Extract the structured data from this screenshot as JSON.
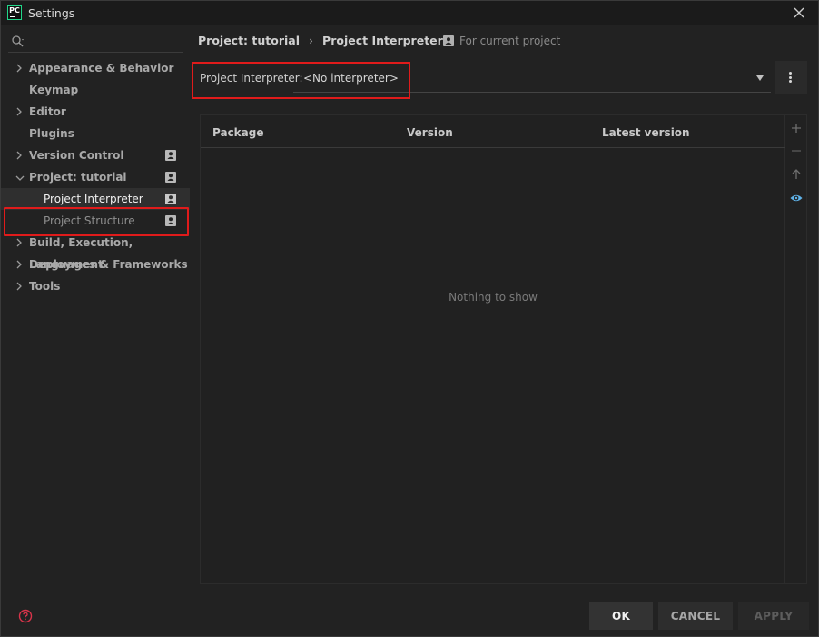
{
  "window": {
    "title": "Settings",
    "logo_text": "PC"
  },
  "search": {
    "placeholder": ""
  },
  "sidebar": {
    "items": [
      {
        "label": "Appearance & Behavior",
        "expandable": true
      },
      {
        "label": "Keymap",
        "expandable": false
      },
      {
        "label": "Editor",
        "expandable": true
      },
      {
        "label": "Plugins",
        "expandable": false
      },
      {
        "label": "Version Control",
        "expandable": true
      },
      {
        "label": "Project: tutorial",
        "expandable": true,
        "expanded": true
      },
      {
        "label": "Project Interpreter",
        "selected": true
      },
      {
        "label": "Project Structure"
      },
      {
        "label": "Build, Execution, Deployment",
        "expandable": true
      },
      {
        "label": "Languages & Frameworks",
        "expandable": true
      },
      {
        "label": "Tools",
        "expandable": true
      }
    ]
  },
  "breadcrumb": {
    "parent": "Project: tutorial",
    "separator": "›",
    "current": "Project Interpreter"
  },
  "scope_note": "For current project",
  "interpreter": {
    "label": "Project Interpreter:",
    "value": "<No interpreter>"
  },
  "packages": {
    "columns": [
      "Package",
      "Version",
      "Latest version"
    ],
    "rows": [],
    "empty_text": "Nothing to show"
  },
  "buttons": {
    "ok": "OK",
    "cancel": "CANCEL",
    "apply": "APPLY"
  },
  "colors": {
    "highlight": "#e01b1b",
    "accent_eye": "#5fb2e8",
    "brand": "#21d789"
  }
}
